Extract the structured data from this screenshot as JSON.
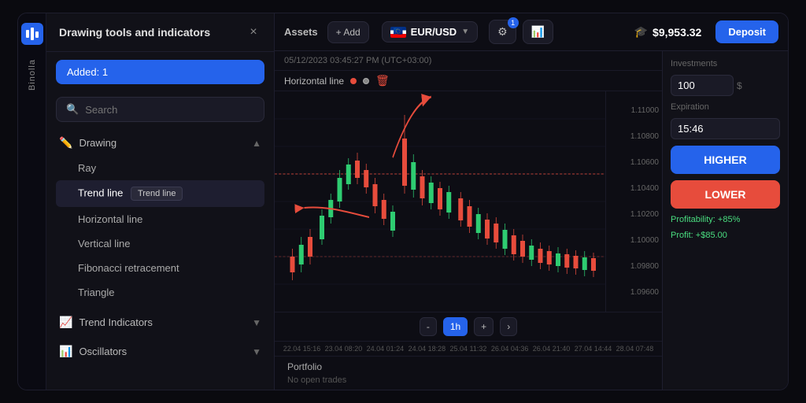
{
  "brand": {
    "name": "Binolla",
    "logo": "B"
  },
  "drawing_panel": {
    "title": "Drawing tools and indicators",
    "close_label": "×",
    "added_badge": "Added: 1",
    "search_placeholder": "Search",
    "drawing_section": {
      "label": "Drawing",
      "icon": "✏",
      "tools": [
        {
          "id": "ray",
          "label": "Ray",
          "active": false
        },
        {
          "id": "trend-line",
          "label": "Trend line",
          "active": true,
          "tooltip": "Trend line"
        },
        {
          "id": "horizontal-line",
          "label": "Horizontal line",
          "active": false
        },
        {
          "id": "vertical-line",
          "label": "Vertical line",
          "active": false
        },
        {
          "id": "fibonacci",
          "label": "Fibonacci retracement",
          "active": false
        },
        {
          "id": "triangle",
          "label": "Triangle",
          "active": false
        }
      ]
    },
    "trend_indicators": {
      "label": "Trend Indicators",
      "icon": "📈"
    },
    "oscillators": {
      "label": "Oscillators",
      "icon": "📊"
    }
  },
  "assets_panel": {
    "title": "Assets",
    "add_label": "+ Add"
  },
  "top_bar": {
    "pair": "EUR/USD",
    "tools_badge": "1",
    "balance": "$9,953.32",
    "deposit_label": "Deposit"
  },
  "chart": {
    "datetime": "05/12/2023 03:45:27 PM (UTC+03:00)",
    "horizontal_line_label": "Horizontal line",
    "timeframes": [
      "-",
      "1h",
      "+",
      ">"
    ],
    "active_tf": "1h",
    "x_labels": [
      "22.04 15:16",
      "23.04 08:20",
      "24.04 01:24",
      "24.04 18:28",
      "25.04 11:32",
      "26.04 04:36",
      "26.04 21:40",
      "27.04 14:44",
      "28.04 07:48"
    ],
    "price_levels": [
      "1.11000",
      "1.10800",
      "1.10600",
      "1.10400",
      "1.10200",
      "1.10000",
      "1.09800",
      "1.09600"
    ]
  },
  "right_panel": {
    "investments_label": "Investments",
    "investments_value": "100",
    "investments_currency": "$",
    "expiration_label": "Expiration",
    "expiration_value": "15:46",
    "higher_label": "HIGHER",
    "lower_label": "LOWER",
    "profitability_label": "Profitability: +85%",
    "profit_label": "Profit: +$85.00"
  },
  "portfolio": {
    "title": "Portfolio",
    "empty_label": "No open trades"
  }
}
